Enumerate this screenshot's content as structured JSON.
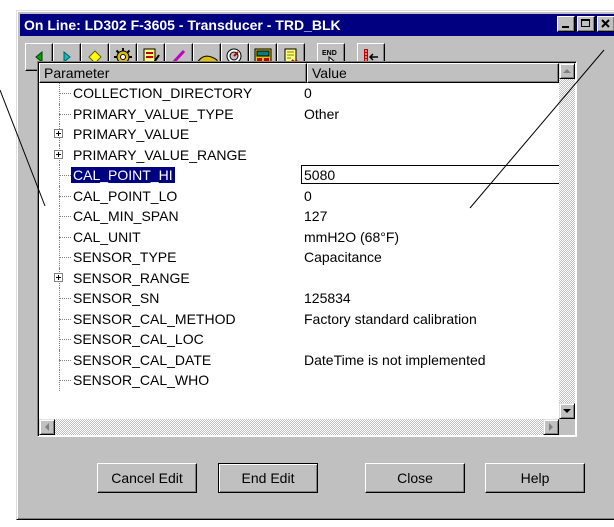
{
  "window": {
    "title": "On Line: LD302 F-3605 - Transducer - TRD_BLK"
  },
  "toolbar": {
    "tools": [
      {
        "name": "back-icon"
      },
      {
        "name": "forward-icon"
      },
      {
        "name": "diamond-icon"
      },
      {
        "name": "gear-icon"
      },
      {
        "name": "edit-block-icon"
      },
      {
        "name": "pen-icon"
      },
      {
        "name": "hill-icon"
      },
      {
        "name": "gauge-icon"
      },
      {
        "name": "display-icon"
      },
      {
        "name": "scroll-icon"
      },
      {
        "name": "end-icon"
      },
      {
        "name": "exit-list-icon"
      }
    ],
    "end_label": "END"
  },
  "table": {
    "headers": {
      "parameter": "Parameter",
      "value": "Value"
    },
    "rows": [
      {
        "name": "COLLECTION_DIRECTORY",
        "value": "0",
        "expandable": false
      },
      {
        "name": "PRIMARY_VALUE_TYPE",
        "value": "Other",
        "expandable": false
      },
      {
        "name": "PRIMARY_VALUE",
        "value": "",
        "expandable": true
      },
      {
        "name": "PRIMARY_VALUE_RANGE",
        "value": "",
        "expandable": true
      },
      {
        "name": "CAL_POINT_HI",
        "value": "5080",
        "expandable": false,
        "selected": true
      },
      {
        "name": "CAL_POINT_LO",
        "value": "0",
        "expandable": false
      },
      {
        "name": "CAL_MIN_SPAN",
        "value": "127",
        "expandable": false
      },
      {
        "name": "CAL_UNIT",
        "value": "mmH2O (68°F)",
        "expandable": false
      },
      {
        "name": "SENSOR_TYPE",
        "value": "Capacitance",
        "expandable": false
      },
      {
        "name": "SENSOR_RANGE",
        "value": "",
        "expandable": true
      },
      {
        "name": "SENSOR_SN",
        "value": "125834",
        "expandable": false
      },
      {
        "name": "SENSOR_CAL_METHOD",
        "value": "Factory  standard calibration",
        "expandable": false
      },
      {
        "name": "SENSOR_CAL_LOC",
        "value": "",
        "expandable": false
      },
      {
        "name": "SENSOR_CAL_DATE",
        "value": "DateTime is not implemented",
        "expandable": false
      },
      {
        "name": "SENSOR_CAL_WHO",
        "value": "",
        "expandable": false
      }
    ]
  },
  "buttons": {
    "cancel_edit": "Cancel Edit",
    "end_edit": "End Edit",
    "close": "Close",
    "help": "Help"
  },
  "colors": {
    "titlebar": "#000080",
    "face": "#c0c0c0",
    "selection": "#000080"
  }
}
